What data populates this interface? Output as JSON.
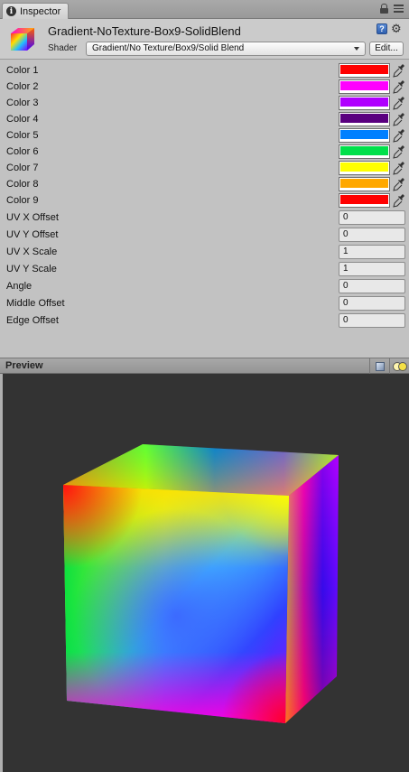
{
  "tab": {
    "label": "Inspector",
    "icon": "info-icon"
  },
  "header": {
    "material_name": "Gradient-NoTexture-Box9-SolidBlend",
    "shader_label": "Shader",
    "shader_value": "Gradient/No Texture/Box9/Solid Blend",
    "edit_label": "Edit...",
    "help_icon": "help-icon",
    "settings_icon": "gear-icon"
  },
  "colors": [
    {
      "label": "Color 1",
      "value": "#ff0000"
    },
    {
      "label": "Color 2",
      "value": "#ff00ff"
    },
    {
      "label": "Color 3",
      "value": "#b000ff"
    },
    {
      "label": "Color 4",
      "value": "#5a007f"
    },
    {
      "label": "Color 5",
      "value": "#0080ff"
    },
    {
      "label": "Color 6",
      "value": "#00e04a"
    },
    {
      "label": "Color 7",
      "value": "#ffff00"
    },
    {
      "label": "Color 8",
      "value": "#ffa800"
    },
    {
      "label": "Color 9",
      "value": "#ff0000"
    }
  ],
  "floats": [
    {
      "label": "UV X Offset",
      "value": "0"
    },
    {
      "label": "UV Y Offset",
      "value": "0"
    },
    {
      "label": "UV X Scale",
      "value": "1"
    },
    {
      "label": "UV Y Scale",
      "value": "1"
    },
    {
      "label": "Angle",
      "value": "0"
    },
    {
      "label": "Middle Offset",
      "value": "0"
    },
    {
      "label": "Edge Offset",
      "value": "0"
    }
  ],
  "preview": {
    "label": "Preview",
    "background": "#333333"
  }
}
